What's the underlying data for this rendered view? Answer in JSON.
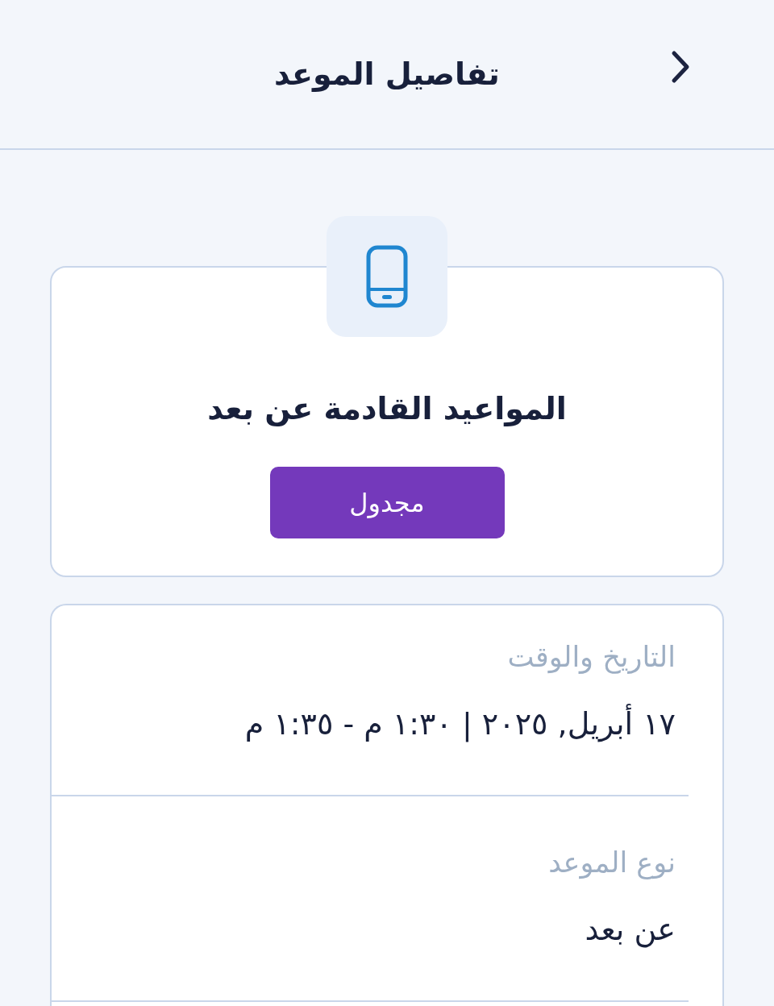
{
  "header": {
    "title": "تفاصيل الموعد"
  },
  "summary": {
    "title": "المواعيد القادمة عن بعد",
    "status": "مجدول"
  },
  "details": [
    {
      "label": "التاريخ والوقت",
      "value": "١٧ أبريل, ٢٠٢٥ | ١:٣٠ م - ١:٣٥ م"
    },
    {
      "label": "نوع الموعد",
      "value": "عن بعد"
    }
  ]
}
